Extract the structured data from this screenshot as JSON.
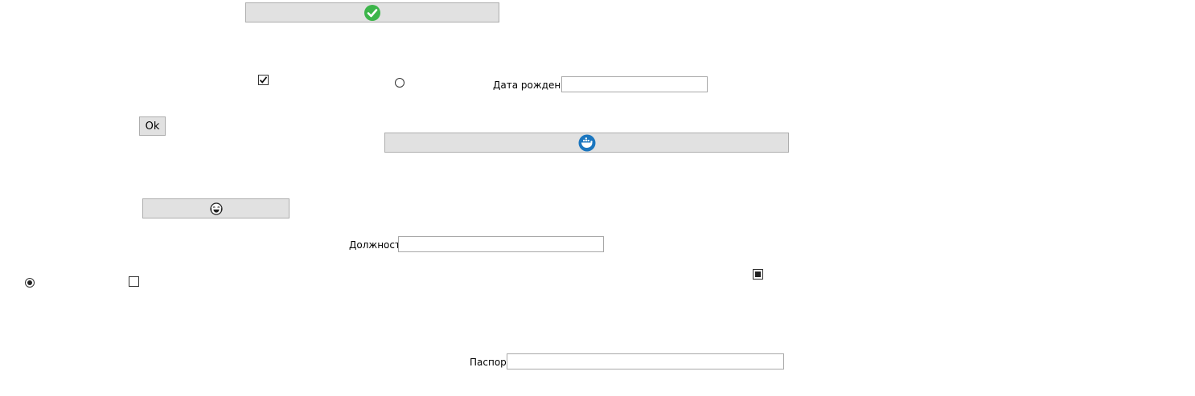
{
  "buttons": {
    "ok_label": "Ok"
  },
  "icons": {
    "top_button_icon": "check-circle-icon",
    "middle_button_icon": "whale-icon",
    "small_button_icon": "emoji-face-icon"
  },
  "fields": {
    "birth_date": {
      "label": "Дата рождения",
      "value": ""
    },
    "position": {
      "label": "Должность",
      "value": ""
    },
    "passport": {
      "label": "Паспорт",
      "value": ""
    }
  },
  "controls": {
    "checkbox_top_checked": true,
    "radio_top_selected": false,
    "radio_left_selected": true,
    "checkbox_left_checked": false,
    "checkbox_right_indeterminate": true
  },
  "colors": {
    "button_bg": "#e1e1e1",
    "button_border": "#adadad",
    "check_green": "#3cb54a",
    "whale_blue": "#1b76bf"
  }
}
